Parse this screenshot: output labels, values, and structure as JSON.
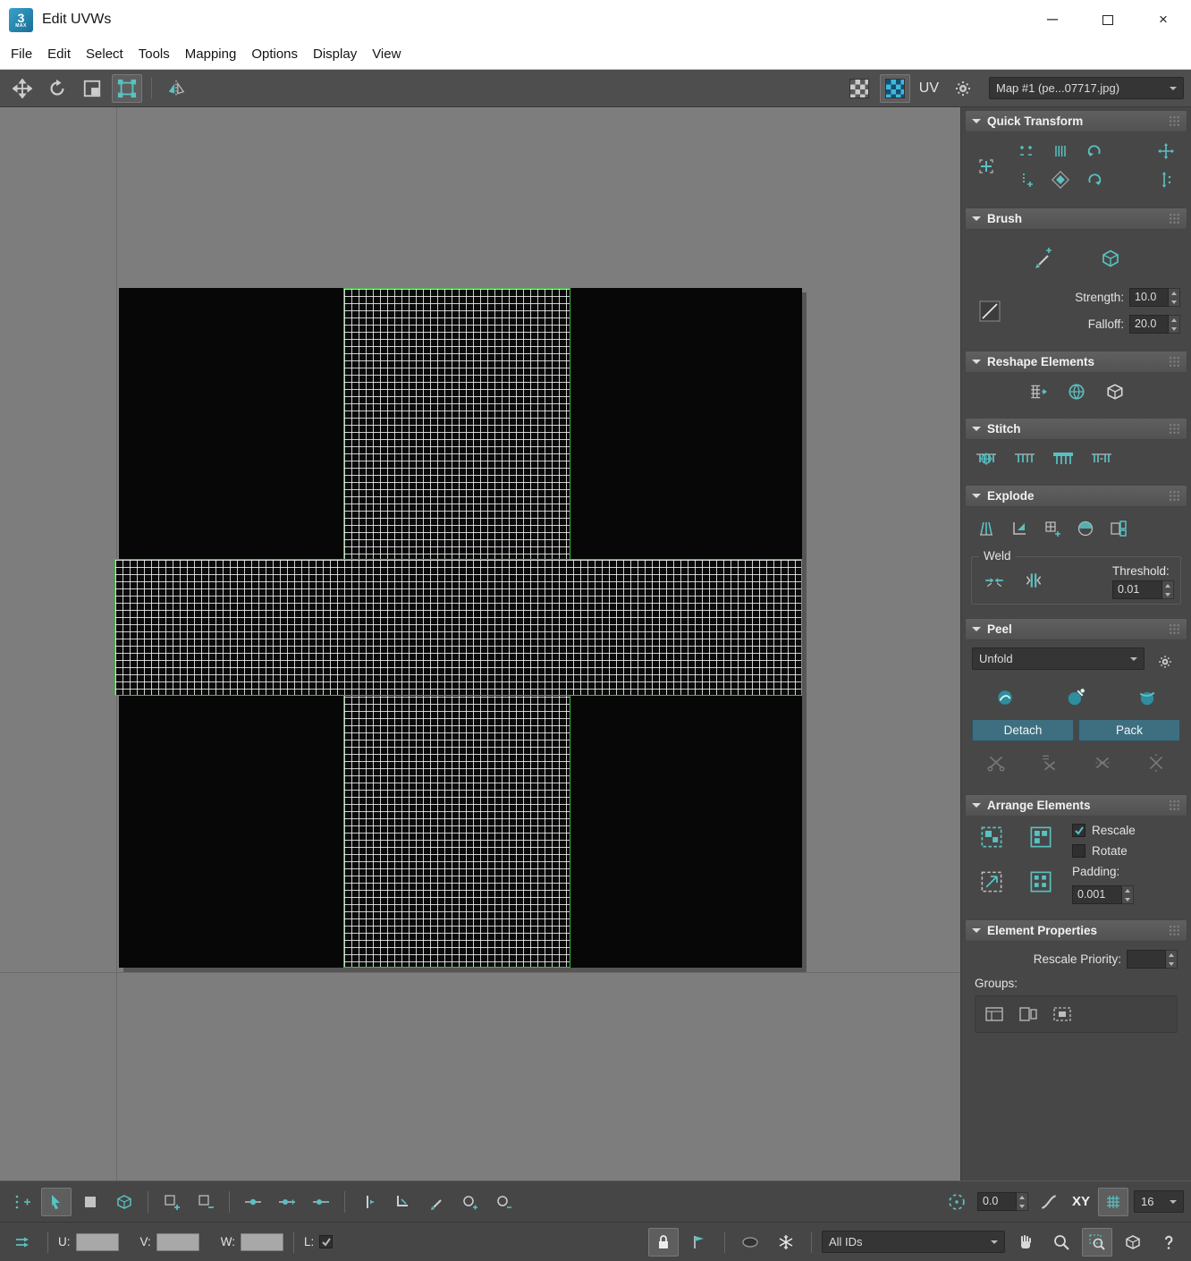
{
  "window": {
    "title": "Edit UVWs",
    "app_badge": "3",
    "app_badge_sub": "MAX",
    "minimize_glyph": "─",
    "close_glyph": "×"
  },
  "menu": {
    "items": [
      "File",
      "Edit",
      "Select",
      "Tools",
      "Mapping",
      "Options",
      "Display",
      "View"
    ]
  },
  "toolbar": {
    "uv_label": "UV",
    "map_selector": "Map #1 (pe...07717.jpg)"
  },
  "colors": {
    "accent_teal": "#5ac1c1",
    "selection_green": "#3fbc3f",
    "panel_bg": "#474747",
    "canvas_bg": "#7d7d7d",
    "texture_tile": "#070707",
    "button_blue": "#3e6f80"
  },
  "panels": {
    "quick_transform": {
      "title": "Quick Transform"
    },
    "brush": {
      "title": "Brush",
      "strength_label": "Strength:",
      "strength_value": "10.0",
      "falloff_label": "Falloff:",
      "falloff_value": "20.0"
    },
    "reshape": {
      "title": "Reshape Elements"
    },
    "stitch": {
      "title": "Stitch"
    },
    "explode": {
      "title": "Explode",
      "weld_label": "Weld",
      "threshold_label": "Threshold:",
      "threshold_value": "0.01"
    },
    "peel": {
      "title": "Peel",
      "mode_value": "Unfold",
      "detach_label": "Detach",
      "pack_label": "Pack"
    },
    "arrange": {
      "title": "Arrange Elements",
      "rescale_label": "Rescale",
      "rescale_checked": true,
      "rotate_label": "Rotate",
      "rotate_checked": false,
      "padding_label": "Padding:",
      "padding_value": "0.001"
    },
    "element_properties": {
      "title": "Element Properties",
      "rescale_priority_label": "Rescale Priority:",
      "rescale_priority_value": "",
      "groups_label": "Groups:"
    }
  },
  "bottom_toolbar": {
    "falloff_value": "0.0",
    "space_label": "XY",
    "grid_size_value": "16"
  },
  "status_bar": {
    "u_label": "U:",
    "v_label": "V:",
    "w_label": "W:",
    "u_value": "",
    "v_value": "",
    "w_value": "",
    "l_label": "L:",
    "l_checked": true,
    "ids_filter": "All IDs"
  }
}
